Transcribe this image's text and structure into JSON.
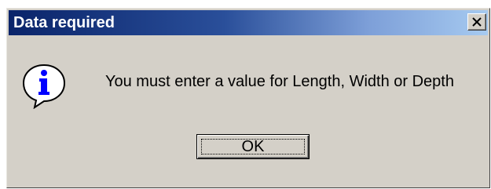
{
  "window": {
    "title": "Data required",
    "close_icon": "close-icon"
  },
  "dialog": {
    "icon": "info-icon",
    "message": "You must enter a value for Length, Width or Depth",
    "ok_label": "OK"
  },
  "colors": {
    "titlebar_start": "#0a246a",
    "titlebar_end": "#a6caf0",
    "dialog_face": "#d4d0c8",
    "info_blue": "#0000ff"
  }
}
